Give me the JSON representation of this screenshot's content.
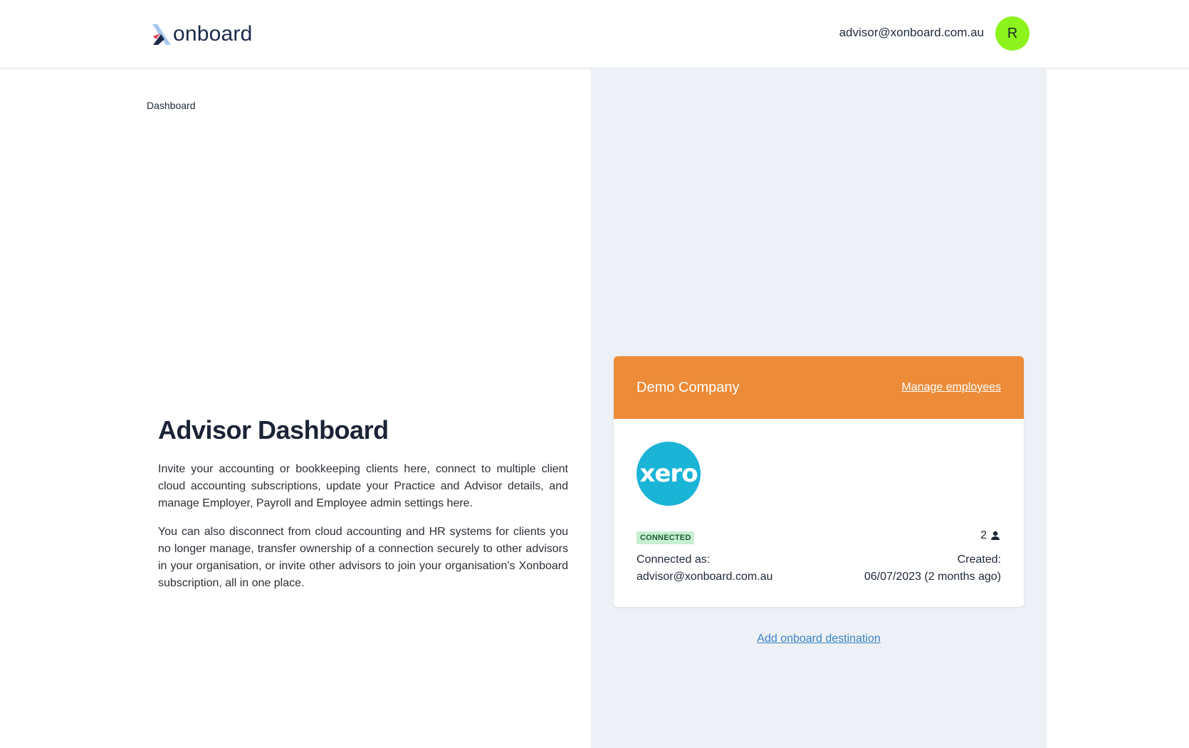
{
  "header": {
    "logo_text": "onboard",
    "user_email": "advisor@xonboard.com.au",
    "avatar_initial": "R"
  },
  "breadcrumb": "Dashboard",
  "main": {
    "title": "Advisor Dashboard",
    "paragraphs": [
      "Invite your accounting or bookkeeping clients here, connect to multiple client cloud accounting subscriptions, update your Practice and Advisor details, and manage Employer, Payroll and Employee admin settings here.",
      "You can also disconnect from cloud accounting and HR systems for clients you no longer manage, transfer ownership of a connection securely to other advisors in your organisation, or invite other advisors to join your organisation's Xonboard subscription, all in one place."
    ]
  },
  "card": {
    "company_name": "Demo Company",
    "manage_label": "Manage employees",
    "integration_logo_text": "xero",
    "status": "CONNECTED",
    "employee_count": "2",
    "connected_as_label": "Connected as:",
    "connected_as_value": "advisor@xonboard.com.au",
    "created_label": "Created:",
    "created_value": "06/07/2023 (2 months ago)"
  },
  "add_destination_label": "Add onboard destination",
  "colors": {
    "card_header": "#ec8b38",
    "avatar": "#8cf31c",
    "xero": "#1ab4d7",
    "panel_bg": "#edf1f5",
    "link": "#3b82c4"
  }
}
